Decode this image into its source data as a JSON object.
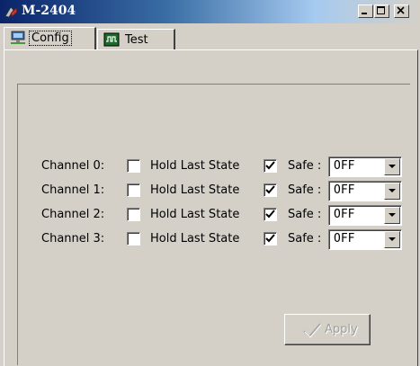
{
  "window": {
    "title": "M-2404"
  },
  "tabs": [
    {
      "label": "Config",
      "selected": true
    },
    {
      "label": "Test",
      "selected": false
    }
  ],
  "channels": [
    {
      "label": "Channel 0:",
      "hold_last_state_label": "Hold Last State",
      "hold_last_state": false,
      "safe_label": "Safe :",
      "safe_checked": true,
      "safe_value": "OFF"
    },
    {
      "label": "Channel 1:",
      "hold_last_state_label": "Hold Last State",
      "hold_last_state": false,
      "safe_label": "Safe :",
      "safe_checked": true,
      "safe_value": "OFF"
    },
    {
      "label": "Channel 2:",
      "hold_last_state_label": "Hold Last State",
      "hold_last_state": false,
      "safe_label": "Safe :",
      "safe_checked": true,
      "safe_value": "OFF"
    },
    {
      "label": "Channel 3:",
      "hold_last_state_label": "Hold Last State",
      "hold_last_state": false,
      "safe_label": "Safe :",
      "safe_checked": true,
      "safe_value": "OFF"
    }
  ],
  "apply": {
    "label": "Apply",
    "enabled": false
  },
  "colors": {
    "titlebar_start": "#0a246a",
    "titlebar_end": "#a6caf0",
    "face": "#d4d0c8"
  }
}
